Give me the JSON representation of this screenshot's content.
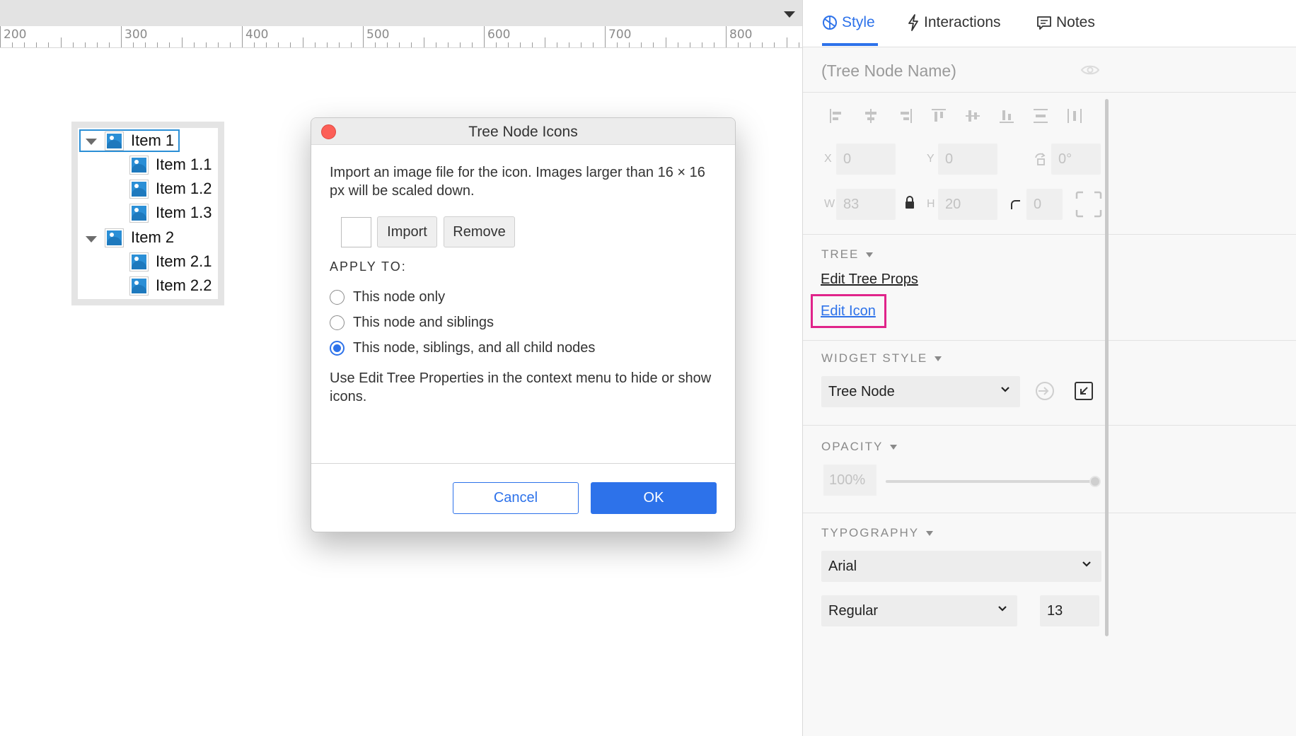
{
  "canvas": {
    "ruler_labels": [
      "200",
      "300",
      "400",
      "500",
      "600",
      "700",
      "800"
    ],
    "tree": [
      {
        "label": "Item 1",
        "expanded": true,
        "level": 0,
        "selected": true
      },
      {
        "label": "Item 1.1",
        "level": 1
      },
      {
        "label": "Item 1.2",
        "level": 1
      },
      {
        "label": "Item 1.3",
        "level": 1
      },
      {
        "label": "Item 2",
        "expanded": true,
        "level": 0
      },
      {
        "label": "Item 2.1",
        "level": 1
      },
      {
        "label": "Item 2.2",
        "level": 1
      }
    ]
  },
  "dialog": {
    "title": "Tree Node Icons",
    "description": "Import an image file for the icon. Images larger than 16 × 16 px will be scaled down.",
    "import_label": "Import",
    "remove_label": "Remove",
    "apply_to_label": "APPLY TO:",
    "options": [
      {
        "label": "This node only",
        "checked": false
      },
      {
        "label": "This node and siblings",
        "checked": false
      },
      {
        "label": "This node, siblings, and all child nodes",
        "checked": true
      }
    ],
    "note": "Use Edit Tree Properties in the context menu to hide or show icons.",
    "cancel_label": "Cancel",
    "ok_label": "OK"
  },
  "panel": {
    "tabs": [
      {
        "label": "Style",
        "icon": "style-icon",
        "active": true
      },
      {
        "label": "Interactions",
        "icon": "lightning-icon",
        "active": false
      },
      {
        "label": "Notes",
        "icon": "note-icon",
        "active": false
      }
    ],
    "node_name_placeholder": "(Tree Node Name)",
    "fields": {
      "x_label": "X",
      "x_value": "0",
      "y_label": "Y",
      "y_value": "0",
      "rotation_value": "0°",
      "w_label": "W",
      "w_value": "83",
      "h_label": "H",
      "h_value": "20",
      "radius_value": "0"
    },
    "tree_section": {
      "title": "TREE",
      "edit_props_label": "Edit Tree Props",
      "edit_icon_label": "Edit Icon"
    },
    "widget_style": {
      "title": "WIDGET STYLE",
      "value": "Tree Node"
    },
    "opacity": {
      "title": "OPACITY",
      "value": "100%",
      "level": 1.0
    },
    "typography": {
      "title": "TYPOGRAPHY",
      "font": "Arial",
      "weight": "Regular",
      "size": "13"
    }
  },
  "colors": {
    "accent": "#2d72ea",
    "highlight": "#e0248a",
    "tree_icon": "#2b8fd6",
    "close_button": "#fc5f57"
  }
}
